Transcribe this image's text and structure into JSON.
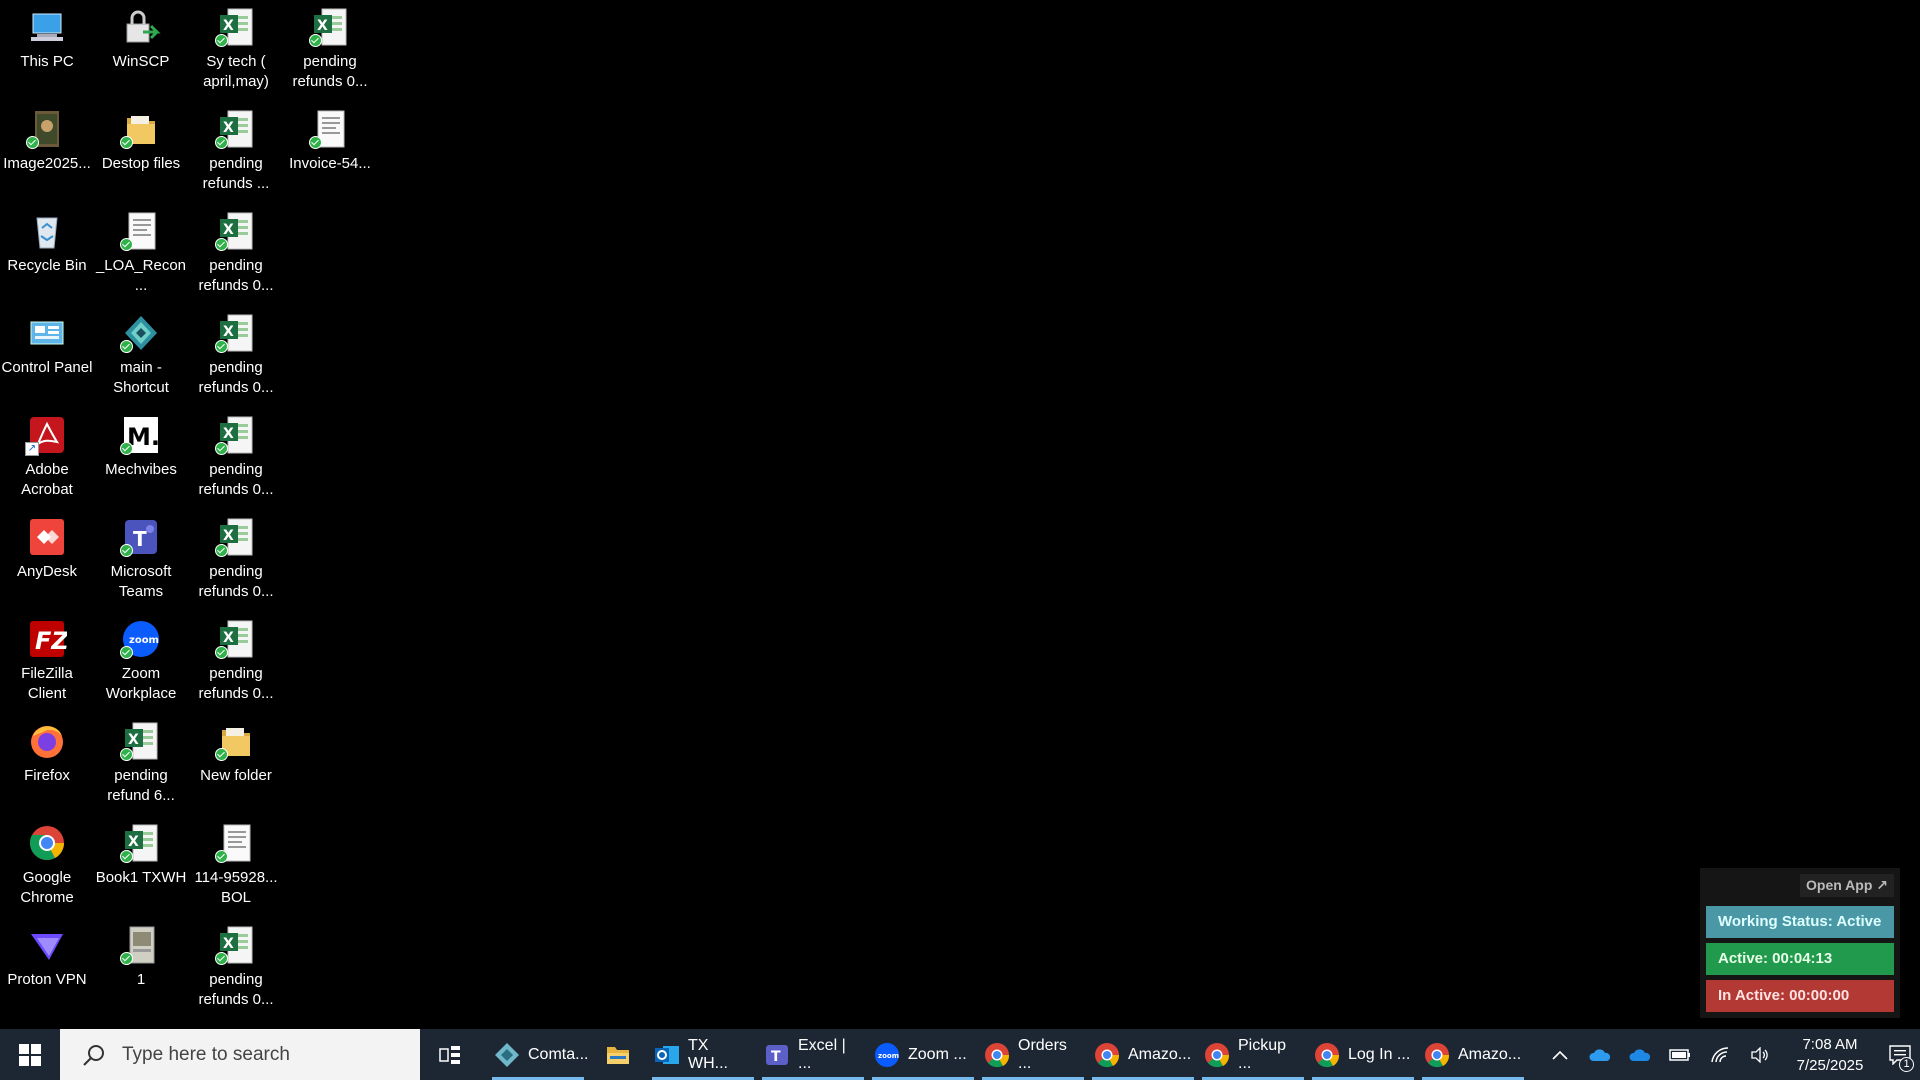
{
  "desktop": {
    "col1": [
      {
        "label": "This PC",
        "icon": "this-pc-icon"
      },
      {
        "label": "Image2025...",
        "icon": "image-file-icon"
      },
      {
        "label": "Recycle Bin",
        "icon": "recycle-bin-icon"
      },
      {
        "label": "Control Panel",
        "icon": "control-panel-icon"
      },
      {
        "label": "Adobe Acrobat",
        "icon": "adobe-acrobat-icon"
      },
      {
        "label": "AnyDesk",
        "icon": "anydesk-icon"
      },
      {
        "label": "FileZilla Client",
        "icon": "filezilla-icon"
      },
      {
        "label": "Firefox",
        "icon": "firefox-icon"
      },
      {
        "label": "Google Chrome",
        "icon": "chrome-icon"
      },
      {
        "label": "Proton VPN",
        "icon": "proton-vpn-icon"
      }
    ],
    "col2": [
      {
        "label": "WinSCP",
        "icon": "winscp-icon"
      },
      {
        "label": "Destop files",
        "icon": "folder-icon"
      },
      {
        "label": "_LOA_Recon...",
        "icon": "document-icon"
      },
      {
        "label": "main - Shortcut",
        "icon": "app-shortcut-icon"
      },
      {
        "label": "Mechvibes",
        "icon": "mechvibes-icon"
      },
      {
        "label": "Microsoft Teams",
        "icon": "teams-icon"
      },
      {
        "label": "Zoom Workplace",
        "icon": "zoom-icon"
      },
      {
        "label": "pending refund 6...",
        "icon": "excel-file-icon"
      },
      {
        "label": "Book1 TXWH",
        "icon": "excel-file-icon"
      },
      {
        "label": "1",
        "icon": "image-file-icon"
      }
    ],
    "col3": [
      {
        "label": "Sy tech ( april,may)",
        "icon": "excel-file-icon"
      },
      {
        "label": "pending refunds ...",
        "icon": "excel-file-icon"
      },
      {
        "label": "pending refunds 0...",
        "icon": "excel-file-icon"
      },
      {
        "label": "pending refunds 0...",
        "icon": "excel-file-icon"
      },
      {
        "label": "pending refunds 0...",
        "icon": "excel-file-icon"
      },
      {
        "label": "pending refunds 0...",
        "icon": "excel-file-icon"
      },
      {
        "label": "pending refunds 0...",
        "icon": "excel-file-icon"
      },
      {
        "label": "New folder",
        "icon": "folder-icon"
      },
      {
        "label": "114-95928... BOL",
        "icon": "document-icon"
      },
      {
        "label": "pending refunds 0...",
        "icon": "excel-file-icon"
      }
    ],
    "col4": [
      {
        "label": "pending refunds 0...",
        "icon": "excel-file-icon"
      },
      {
        "label": "Invoice-54...",
        "icon": "document-icon"
      }
    ]
  },
  "widget": {
    "open_app": "Open App ↗",
    "working_status": "Working Status: Active",
    "active": "Active: 00:04:13",
    "inactive": "In Active: 00:00:00"
  },
  "taskbar": {
    "search_placeholder": "Type here to search",
    "apps": [
      {
        "label": "Comta...",
        "icon": "comta-icon"
      },
      {
        "label": "",
        "icon": "file-explorer-icon"
      },
      {
        "label": "TX WH...",
        "icon": "outlook-icon"
      },
      {
        "label": "Excel | ...",
        "icon": "teams-icon"
      },
      {
        "label": "Zoom ...",
        "icon": "zoom-icon"
      },
      {
        "label": "Orders ...",
        "icon": "chrome-icon"
      },
      {
        "label": "Amazo...",
        "icon": "chrome-icon"
      },
      {
        "label": "Pickup ...",
        "icon": "chrome-icon"
      },
      {
        "label": "Log In ...",
        "icon": "chrome-icon"
      },
      {
        "label": "Amazo...",
        "icon": "chrome-icon"
      }
    ],
    "time": "7:08 AM",
    "date": "7/25/2025",
    "notification_count": "1"
  }
}
